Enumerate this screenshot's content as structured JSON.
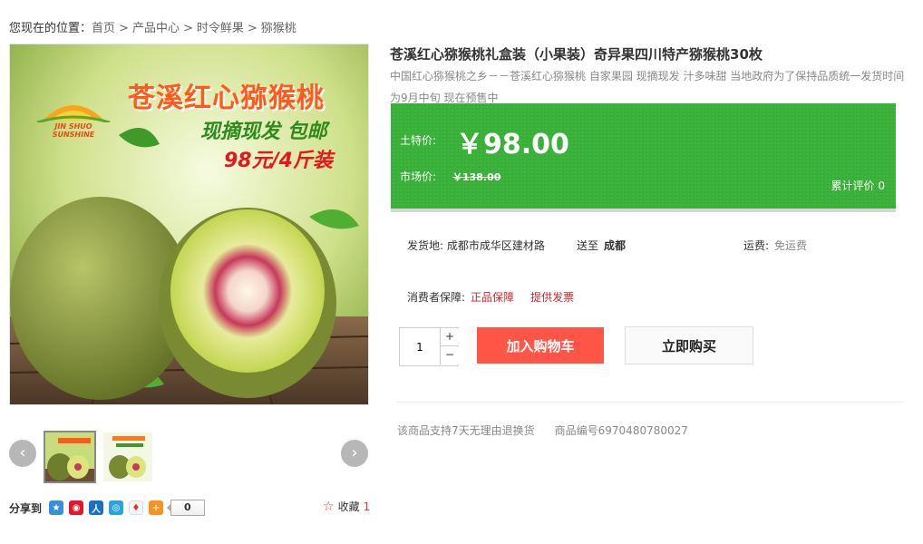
{
  "breadcrumb": {
    "lead": "您现在的位置：",
    "items": [
      "首页",
      "产品中心",
      "时令鲜果",
      "猕猴桃"
    ],
    "separator": ">"
  },
  "main_image": {
    "headline": "苍溪红心猕猴桃",
    "subline": "现摘现发  包邮",
    "price_line": "98元/4斤装",
    "logo_text": "JIN SHUO SUNSHINE"
  },
  "thumbnails": {
    "prev": "‹",
    "next": "›",
    "count": 2,
    "active_index": 0
  },
  "share": {
    "label": "分享到",
    "count": "0",
    "icons": [
      "qzone-icon",
      "weibo-icon",
      "renren-icon",
      "tqq-icon",
      "qq-icon",
      "more-icon"
    ]
  },
  "collect": {
    "label": "收藏",
    "count": "1"
  },
  "product": {
    "title": "苍溪红心猕猴桃礼盒装（小果装）奇异果四川特产猕猴桃30枚",
    "description": "中国红心猕猴桃之乡－－苍溪红心猕猴桃 自家果园 现摘现发 汁多味甜 当地政府为了保持品质统一发货时间为9月中旬 现在预售中"
  },
  "price": {
    "label": "土特价:",
    "value": "￥98.00",
    "market_label": "市场价:",
    "market_value": "￥138.00",
    "review_label": "累计评价",
    "review_count": "0"
  },
  "shipping": {
    "from_label": "发货地:",
    "from_value": "成都市成华区建材路",
    "to_label": "送至",
    "to_value": "成都",
    "fee_label": "运费:",
    "fee_value": "免运费"
  },
  "guarantee": {
    "label": "消费者保障:",
    "items": [
      "正品保障",
      "提供发票"
    ]
  },
  "quantity": {
    "value": "1",
    "plus": "+",
    "minus": "−"
  },
  "buttons": {
    "cart": "加入购物车",
    "buy": "立即购买"
  },
  "footer": {
    "return_policy": "该商品支持7天无理由退换货",
    "product_code": "商品编号6970480780027"
  },
  "colors": {
    "price_bg": "#3cb43c",
    "cart_btn": "#ff5546",
    "guarantee_text": "#c62a2a"
  }
}
